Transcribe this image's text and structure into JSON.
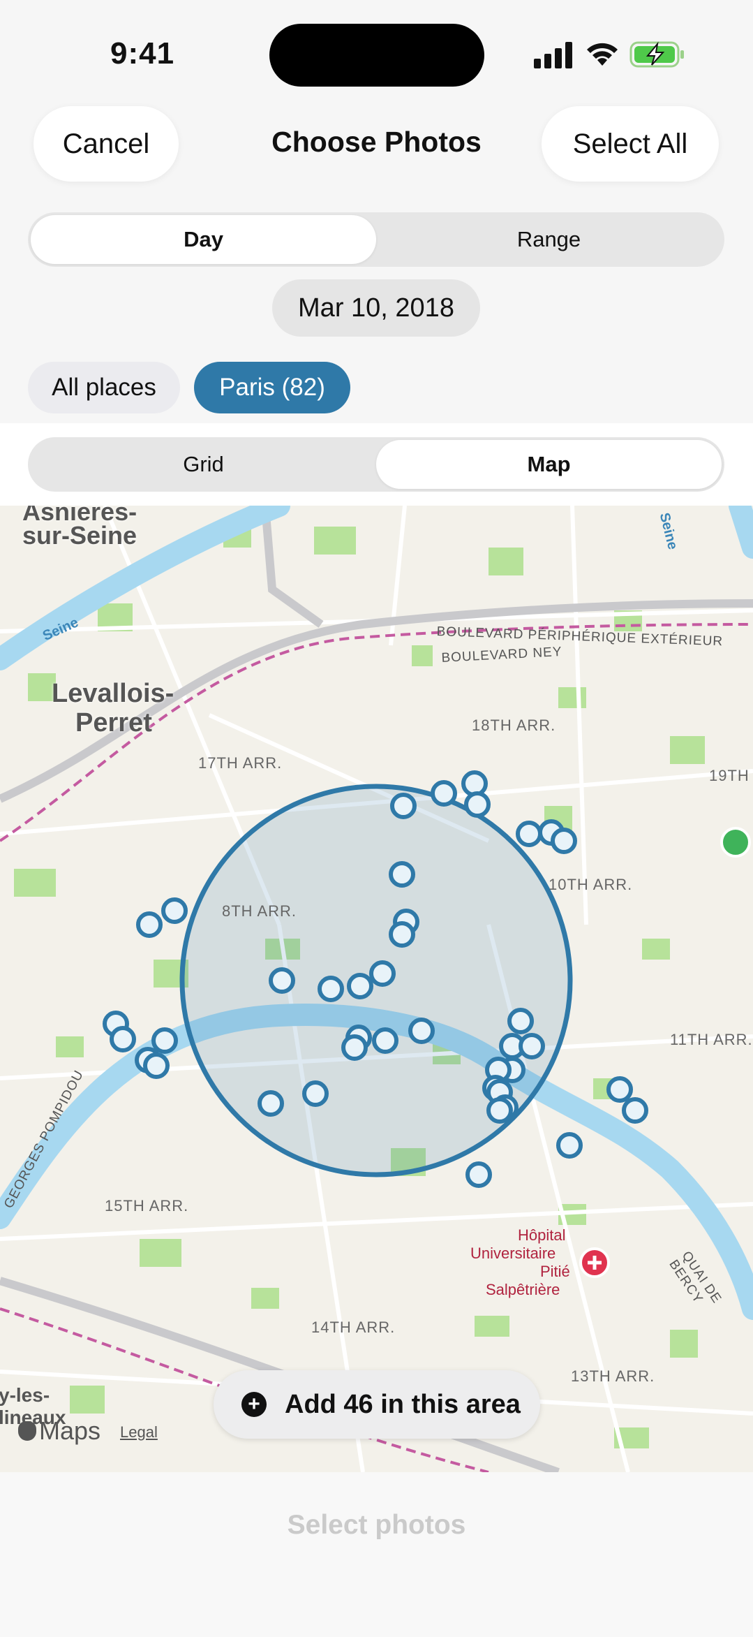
{
  "status": {
    "time": "9:41"
  },
  "nav": {
    "cancel": "Cancel",
    "title": "Choose Photos",
    "select_all": "Select All"
  },
  "mode": {
    "day": "Day",
    "range": "Range",
    "selected": "Day"
  },
  "date": "Mar 10, 2018",
  "places": {
    "all": "All places",
    "paris": "Paris (82)"
  },
  "view": {
    "grid": "Grid",
    "map": "Map",
    "selected": "Map"
  },
  "map": {
    "labels": {
      "asnieres": "Asnières-",
      "asnieres2": "sur-Seine",
      "levallois": "Levallois-",
      "levallois2": "Perret",
      "arr17": "17TH ARR.",
      "arr18": "18TH ARR.",
      "arr19": "19TH",
      "arr8": "8TH ARR.",
      "arr10": "10TH ARR.",
      "arr11": "11TH ARR.",
      "arr15": "15TH ARR.",
      "arr14": "14TH ARR.",
      "arr13": "13TH ARR.",
      "blvd_peripherique": "BOULEVARD PÉRIPHÉRIQUE EXTÉRIEUR",
      "blvd_ney": "BOULEVARD NEY",
      "seine1": "Seine",
      "seine2": "Seine",
      "georges_pompidou": "GEORGES POMPIDOU",
      "quai_de_bercy": "QUAI DE BERCY",
      "hopital1": "Hôpital",
      "hopital2": "Universitaire",
      "hopital3": "Pitié",
      "hopital4": "Salpêtrière",
      "moulineaux1": "y-les-",
      "moulineaux2": "lineaux"
    },
    "add_button": "Add 46 in this area",
    "brand": "Maps",
    "legal": "Legal",
    "colors": {
      "water": "#a7d8f0",
      "park": "#b7e29a",
      "accent": "#2f79a8",
      "road": "#ffffff",
      "highway": "#c9c9cc",
      "boundary": "#c45aa0"
    }
  },
  "footer": {
    "select_photos": "Select photos"
  }
}
